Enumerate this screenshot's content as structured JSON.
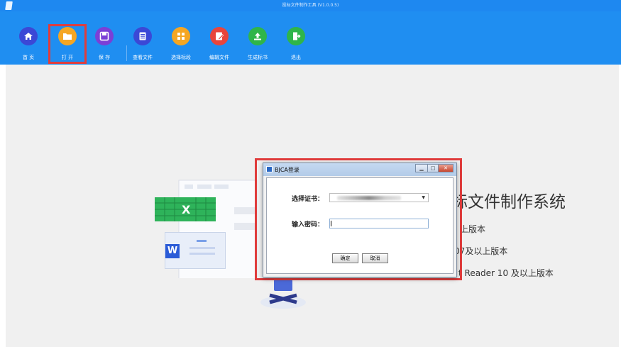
{
  "app": {
    "title": "投标文件制作工具 (V1.0.0.5)"
  },
  "toolbar": {
    "items": [
      {
        "label": "首 页",
        "icon": "home-icon",
        "color": "#3b48d6"
      },
      {
        "label": "打 开",
        "icon": "folder-icon",
        "color": "#f5a623"
      },
      {
        "label": "保 存",
        "icon": "save-icon",
        "color": "#7b3fd6"
      },
      {
        "label": "查看文件",
        "icon": "document-list-icon",
        "color": "#3b48d6"
      },
      {
        "label": "选择标段",
        "icon": "grid-icon",
        "color": "#f5a623"
      },
      {
        "label": "编辑文件",
        "icon": "edit-icon",
        "color": "#e8453c"
      },
      {
        "label": "生成标书",
        "icon": "upload-icon",
        "color": "#2fb54a"
      },
      {
        "label": "退出",
        "icon": "exit-icon",
        "color": "#2fb54a"
      }
    ]
  },
  "main": {
    "headline": "标文件制作系统",
    "lines": [
      "上版本",
      "07及以上版本",
      "t Reader 10 及以上版本"
    ]
  },
  "dialog": {
    "title": "BJCA登录",
    "cert_label": "选择证书：",
    "cert_value": "",
    "password_label": "输入密码：",
    "password_value": "",
    "ok_label": "确定",
    "cancel_label": "取消",
    "minimize": "▁",
    "maximize": "□",
    "close": "✕"
  },
  "illustration": {
    "excel_letter": "X",
    "word_letter": "W"
  }
}
